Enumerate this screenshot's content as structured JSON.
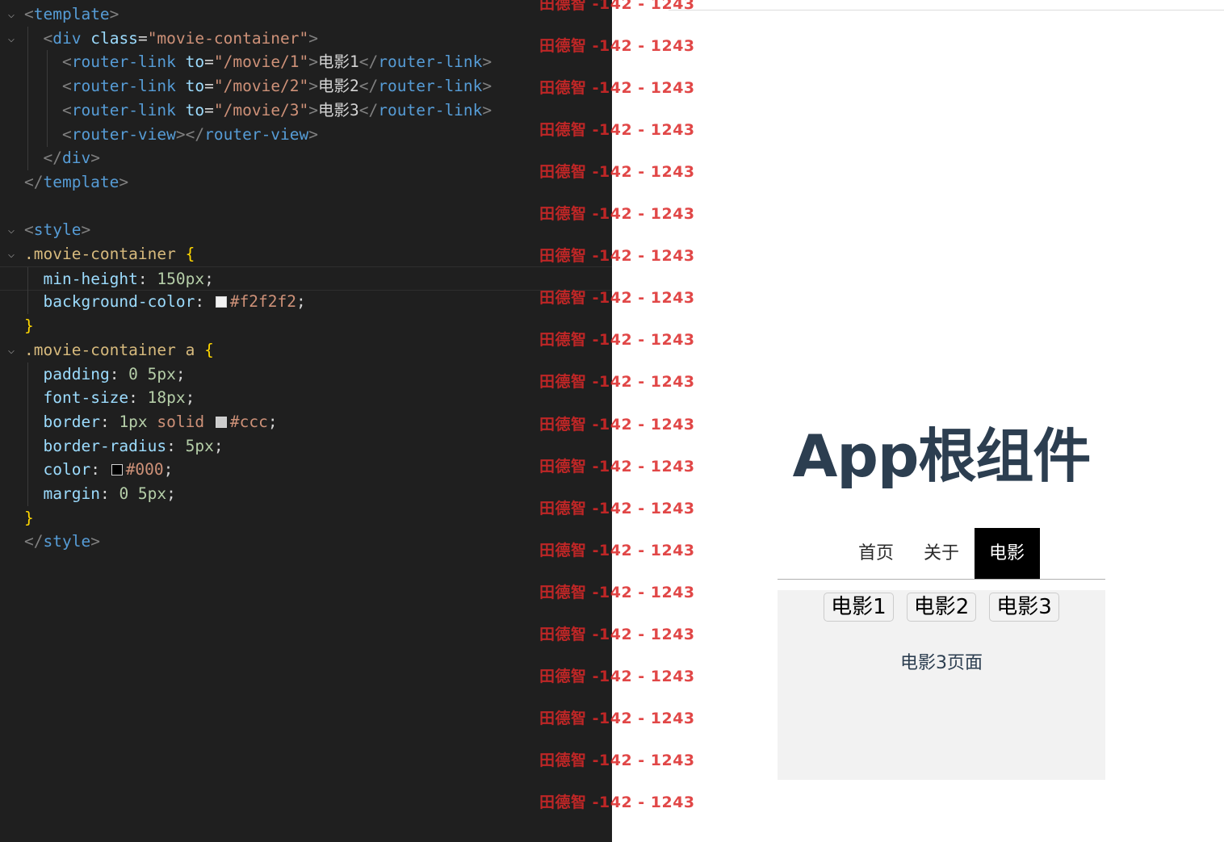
{
  "editor": {
    "lines": [
      {
        "fold": "⌵",
        "indent": 0,
        "tokens": [
          {
            "c": "t-tag",
            "t": "<"
          },
          {
            "c": "t-name",
            "t": "template"
          },
          {
            "c": "t-tag",
            "t": ">"
          }
        ]
      },
      {
        "fold": "⌵",
        "indent": 1,
        "tokens": [
          {
            "c": "t-tag",
            "t": "<"
          },
          {
            "c": "t-name",
            "t": "div"
          },
          {
            "c": "t-attr",
            "t": " class"
          },
          {
            "c": "t-punc",
            "t": "="
          },
          {
            "c": "t-str",
            "t": "\"movie-container\""
          },
          {
            "c": "t-tag",
            "t": ">"
          }
        ]
      },
      {
        "fold": "",
        "indent": 2,
        "tokens": [
          {
            "c": "t-tag",
            "t": "<"
          },
          {
            "c": "t-name",
            "t": "router-link"
          },
          {
            "c": "t-attr",
            "t": " to"
          },
          {
            "c": "t-punc",
            "t": "="
          },
          {
            "c": "t-str",
            "t": "\"/movie/1\""
          },
          {
            "c": "t-tag",
            "t": ">"
          },
          {
            "c": "t-text",
            "t": "电影1"
          },
          {
            "c": "t-tag",
            "t": "</"
          },
          {
            "c": "t-name",
            "t": "router-link"
          },
          {
            "c": "t-tag",
            "t": ">"
          }
        ]
      },
      {
        "fold": "",
        "indent": 2,
        "tokens": [
          {
            "c": "t-tag",
            "t": "<"
          },
          {
            "c": "t-name",
            "t": "router-link"
          },
          {
            "c": "t-attr",
            "t": " to"
          },
          {
            "c": "t-punc",
            "t": "="
          },
          {
            "c": "t-str",
            "t": "\"/movie/2\""
          },
          {
            "c": "t-tag",
            "t": ">"
          },
          {
            "c": "t-text",
            "t": "电影2"
          },
          {
            "c": "t-tag",
            "t": "</"
          },
          {
            "c": "t-name",
            "t": "router-link"
          },
          {
            "c": "t-tag",
            "t": ">"
          }
        ]
      },
      {
        "fold": "",
        "indent": 2,
        "tokens": [
          {
            "c": "t-tag",
            "t": "<"
          },
          {
            "c": "t-name",
            "t": "router-link"
          },
          {
            "c": "t-attr",
            "t": " to"
          },
          {
            "c": "t-punc",
            "t": "="
          },
          {
            "c": "t-str",
            "t": "\"/movie/3\""
          },
          {
            "c": "t-tag",
            "t": ">"
          },
          {
            "c": "t-text",
            "t": "电影3"
          },
          {
            "c": "t-tag",
            "t": "</"
          },
          {
            "c": "t-name",
            "t": "router-link"
          },
          {
            "c": "t-tag",
            "t": ">"
          }
        ]
      },
      {
        "fold": "",
        "indent": 2,
        "tokens": [
          {
            "c": "t-tag",
            "t": "<"
          },
          {
            "c": "t-name",
            "t": "router-view"
          },
          {
            "c": "t-tag",
            "t": "></"
          },
          {
            "c": "t-name",
            "t": "router-view"
          },
          {
            "c": "t-tag",
            "t": ">"
          }
        ]
      },
      {
        "fold": "",
        "indent": 1,
        "tokens": [
          {
            "c": "t-tag",
            "t": "</"
          },
          {
            "c": "t-name",
            "t": "div"
          },
          {
            "c": "t-tag",
            "t": ">"
          }
        ]
      },
      {
        "fold": "",
        "indent": 0,
        "tokens": [
          {
            "c": "t-tag",
            "t": "</"
          },
          {
            "c": "t-name",
            "t": "template"
          },
          {
            "c": "t-tag",
            "t": ">"
          }
        ]
      },
      {
        "fold": "",
        "indent": 0,
        "tokens": []
      },
      {
        "fold": "⌵",
        "indent": 0,
        "tokens": [
          {
            "c": "t-tag",
            "t": "<"
          },
          {
            "c": "t-name",
            "t": "style"
          },
          {
            "c": "t-tag",
            "t": ">"
          }
        ]
      },
      {
        "fold": "⌵",
        "indent": 0,
        "tokens": [
          {
            "c": "t-sel",
            "t": ".movie-container"
          },
          {
            "c": "t-punc",
            "t": " "
          },
          {
            "c": "t-brace",
            "t": "{"
          }
        ]
      },
      {
        "fold": "",
        "indent": 1,
        "active": true,
        "tokens": [
          {
            "c": "t-prop",
            "t": "min-height"
          },
          {
            "c": "t-punc",
            "t": ": "
          },
          {
            "c": "t-num",
            "t": "150px"
          },
          {
            "c": "t-punc",
            "t": ";"
          }
        ]
      },
      {
        "fold": "",
        "indent": 1,
        "tokens": [
          {
            "c": "t-prop",
            "t": "background-color"
          },
          {
            "c": "t-punc",
            "t": ": "
          },
          {
            "c": "swatch",
            "color": "#f2f2f2"
          },
          {
            "c": "t-val",
            "t": "#f2f2f2"
          },
          {
            "c": "t-punc",
            "t": ";"
          }
        ]
      },
      {
        "fold": "",
        "indent": 0,
        "tokens": [
          {
            "c": "t-brace",
            "t": "}"
          }
        ]
      },
      {
        "fold": "⌵",
        "indent": 0,
        "tokens": [
          {
            "c": "t-sel",
            "t": ".movie-container a"
          },
          {
            "c": "t-punc",
            "t": " "
          },
          {
            "c": "t-brace",
            "t": "{"
          }
        ]
      },
      {
        "fold": "",
        "indent": 1,
        "tokens": [
          {
            "c": "t-prop",
            "t": "padding"
          },
          {
            "c": "t-punc",
            "t": ": "
          },
          {
            "c": "t-num",
            "t": "0 5px"
          },
          {
            "c": "t-punc",
            "t": ";"
          }
        ]
      },
      {
        "fold": "",
        "indent": 1,
        "tokens": [
          {
            "c": "t-prop",
            "t": "font-size"
          },
          {
            "c": "t-punc",
            "t": ": "
          },
          {
            "c": "t-num",
            "t": "18px"
          },
          {
            "c": "t-punc",
            "t": ";"
          }
        ]
      },
      {
        "fold": "",
        "indent": 1,
        "tokens": [
          {
            "c": "t-prop",
            "t": "border"
          },
          {
            "c": "t-punc",
            "t": ": "
          },
          {
            "c": "t-num",
            "t": "1px"
          },
          {
            "c": "t-val",
            "t": " solid "
          },
          {
            "c": "swatch",
            "color": "#cccccc"
          },
          {
            "c": "t-val",
            "t": "#ccc"
          },
          {
            "c": "t-punc",
            "t": ";"
          }
        ]
      },
      {
        "fold": "",
        "indent": 1,
        "tokens": [
          {
            "c": "t-prop",
            "t": "border-radius"
          },
          {
            "c": "t-punc",
            "t": ": "
          },
          {
            "c": "t-num",
            "t": "5px"
          },
          {
            "c": "t-punc",
            "t": ";"
          }
        ]
      },
      {
        "fold": "",
        "indent": 1,
        "tokens": [
          {
            "c": "t-prop",
            "t": "color"
          },
          {
            "c": "t-punc",
            "t": ": "
          },
          {
            "c": "swatch",
            "color": "#000000"
          },
          {
            "c": "t-val",
            "t": "#000"
          },
          {
            "c": "t-punc",
            "t": ";"
          }
        ]
      },
      {
        "fold": "",
        "indent": 1,
        "tokens": [
          {
            "c": "t-prop",
            "t": "margin"
          },
          {
            "c": "t-punc",
            "t": ": "
          },
          {
            "c": "t-num",
            "t": "0 5px"
          },
          {
            "c": "t-punc",
            "t": ";"
          }
        ]
      },
      {
        "fold": "",
        "indent": 0,
        "tokens": [
          {
            "c": "t-brace",
            "t": "}"
          }
        ]
      },
      {
        "fold": "",
        "indent": 0,
        "tokens": [
          {
            "c": "t-tag",
            "t": "</"
          },
          {
            "c": "t-name",
            "t": "style"
          },
          {
            "c": "t-tag",
            "t": ">"
          }
        ]
      }
    ]
  },
  "preview": {
    "app_title": "App根组件",
    "nav": [
      {
        "label": "首页",
        "active": false
      },
      {
        "label": "关于",
        "active": false
      },
      {
        "label": "电影",
        "active": true
      }
    ],
    "movie_links": [
      "电影1",
      "电影2",
      "电影3"
    ],
    "movie_page_text": "电影3页面"
  },
  "watermark": {
    "text": "田德智 -142 - 1243",
    "color": "#dc2828"
  }
}
